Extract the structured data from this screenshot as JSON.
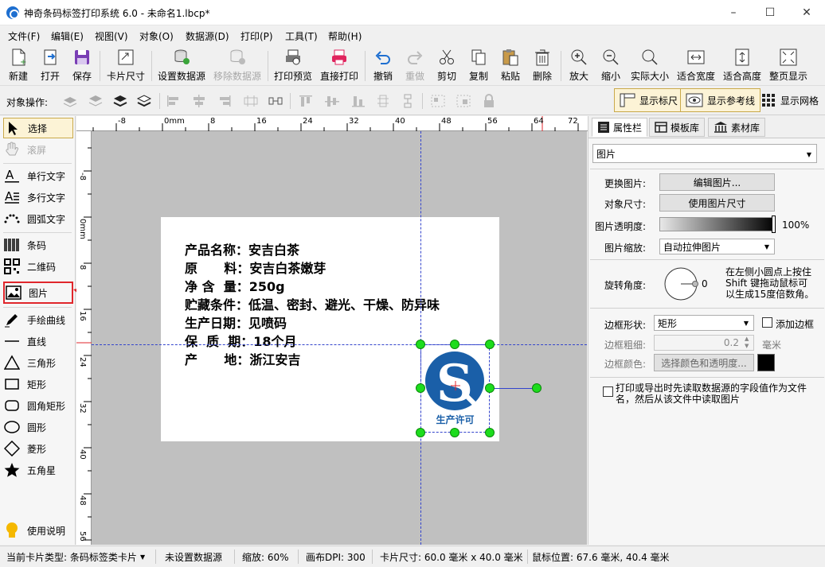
{
  "title": "神奇条码标签打印系统 6.0 - 未命名1.lbcp*",
  "menu": [
    "文件(F)",
    "编辑(E)",
    "视图(V)",
    "对象(O)",
    "数据源(D)",
    "打印(P)",
    "工具(T)",
    "帮助(H)"
  ],
  "toolbar": {
    "new": "新建",
    "open": "打开",
    "save": "保存",
    "card_size": "卡片尺寸",
    "set_datasource": "设置数据源",
    "remove_datasource": "移除数据源",
    "print_preview": "打印预览",
    "direct_print": "直接打印",
    "undo": "撤销",
    "redo": "重做",
    "cut": "剪切",
    "copy": "复制",
    "paste": "粘贴",
    "delete": "删除",
    "zoom_in": "放大",
    "zoom_out": "缩小",
    "actual_size": "实际大小",
    "fit_width": "适合宽度",
    "fit_height": "适合高度",
    "fit_page": "整页显示"
  },
  "objbar": {
    "label": "对象操作:",
    "show_ruler": "显示标尺",
    "show_guides": "显示参考线",
    "show_grid": "显示网格"
  },
  "tools": {
    "select": "选择",
    "scroll": "滚屏",
    "single_text": "单行文字",
    "multi_text": "多行文字",
    "arc_text": "圆弧文字",
    "barcode": "条码",
    "qrcode": "二维码",
    "image": "图片",
    "freehand": "手绘曲线",
    "line": "直线",
    "triangle": "三角形",
    "rect": "矩形",
    "round_rect": "圆角矩形",
    "circle": "圆形",
    "diamond": "菱形",
    "star": "五角星",
    "help": "使用说明"
  },
  "ruler": {
    "h_labels": [
      "-8",
      "0mm",
      "8",
      "16",
      "24",
      "32",
      "40",
      "48",
      "56",
      "64",
      "72"
    ],
    "v_labels": [
      "-8",
      "0mm",
      "8",
      "16",
      "24",
      "32",
      "40",
      "48",
      "56"
    ]
  },
  "label_lines": [
    "产品名称：安吉白茶",
    "原      料：安吉白茶嫩芽",
    "净 含  量：250g",
    "贮藏条件：低温、密封、避光、干燥、防异味",
    "生产日期：见喷码",
    "保  质  期：18个月",
    "产      地：浙江安吉"
  ],
  "logo_text": "生产许可",
  "panel": {
    "tabs": [
      "属性栏",
      "模板库",
      "素材库"
    ],
    "object_type": "图片",
    "change_image": "更换图片:",
    "edit_image_btn": "编辑图片...",
    "object_size": "对象尺寸:",
    "use_image_size_btn": "使用图片尺寸",
    "transparency": "图片透明度:",
    "transparency_value": "100%",
    "scaling": "图片缩放:",
    "scaling_value": "自动拉伸图片",
    "rotation": "旋转角度:",
    "rotation_value": "0",
    "rotation_hint": "在左侧小圆点上按住Shift 键拖动鼠标可以生成15度倍数角。",
    "border_shape": "边框形状:",
    "border_shape_value": "矩形",
    "add_border": "添加边框",
    "border_width": "边框粗细:",
    "border_width_value": "0.2",
    "border_unit": "毫米",
    "border_color": "边框颜色:",
    "border_color_btn": "选择颜色和透明度...",
    "print_option": "打印或导出时先读取数据源的字段值作为文件名，然后从该文件中读取图片"
  },
  "status": {
    "card_type": "当前卡片类型: 条码标签类卡片",
    "datasource": "未设置数据源",
    "zoom": "缩放: 60%",
    "dpi": "画布DPI: 300",
    "card_size": "卡片尺寸: 60.0 毫米 x 40.0 毫米",
    "mouse_pos": "鼠标位置: 67.6 毫米, 40.4 毫米"
  }
}
